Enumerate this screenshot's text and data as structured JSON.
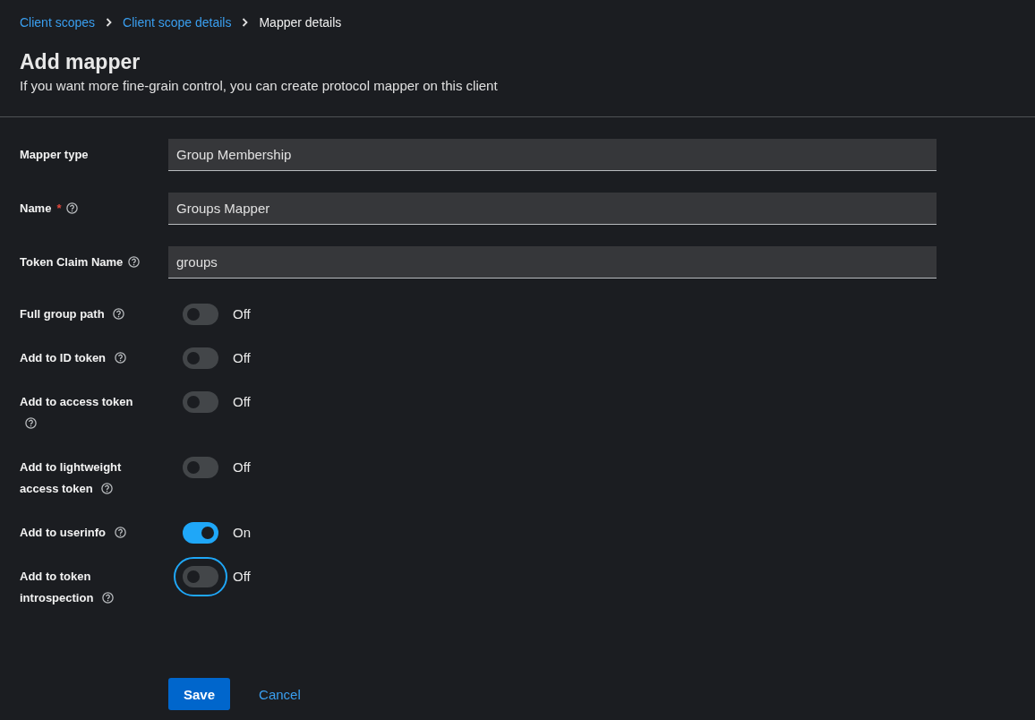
{
  "breadcrumb": [
    {
      "label": "Client scopes",
      "current": false
    },
    {
      "label": "Client scope details",
      "current": false
    },
    {
      "label": "Mapper details",
      "current": true
    }
  ],
  "title": "Add mapper",
  "subtitle": "If you want more fine-grain control, you can create protocol mapper on this client",
  "fields": [
    {
      "label": "Mapper type",
      "help": false,
      "value": "Group Membership"
    },
    {
      "label": "Name",
      "required_mark": "*",
      "help": true,
      "value": "Groups Mapper"
    },
    {
      "label": "Token Claim Name",
      "help": true,
      "value": "groups"
    }
  ],
  "switches": [
    {
      "label": "Full group path",
      "help": true,
      "on": false,
      "state_label": "Off",
      "focused": false
    },
    {
      "label": "Add to ID token",
      "help": true,
      "on": false,
      "state_label": "Off",
      "focused": false
    },
    {
      "label": "Add to access token",
      "help": true,
      "on": false,
      "state_label": "Off",
      "focused": false
    },
    {
      "label": "Add to lightweight access token",
      "help": true,
      "on": false,
      "state_label": "Off",
      "focused": false
    },
    {
      "label": "Add to userinfo",
      "help": true,
      "on": true,
      "state_label": "On",
      "focused": false
    },
    {
      "label": "Add to token introspection",
      "help": true,
      "on": false,
      "state_label": "Off",
      "focused": true
    }
  ],
  "buttons": [
    {
      "label": "Save",
      "kind": "primary"
    },
    {
      "label": "Cancel",
      "kind": "link"
    }
  ]
}
